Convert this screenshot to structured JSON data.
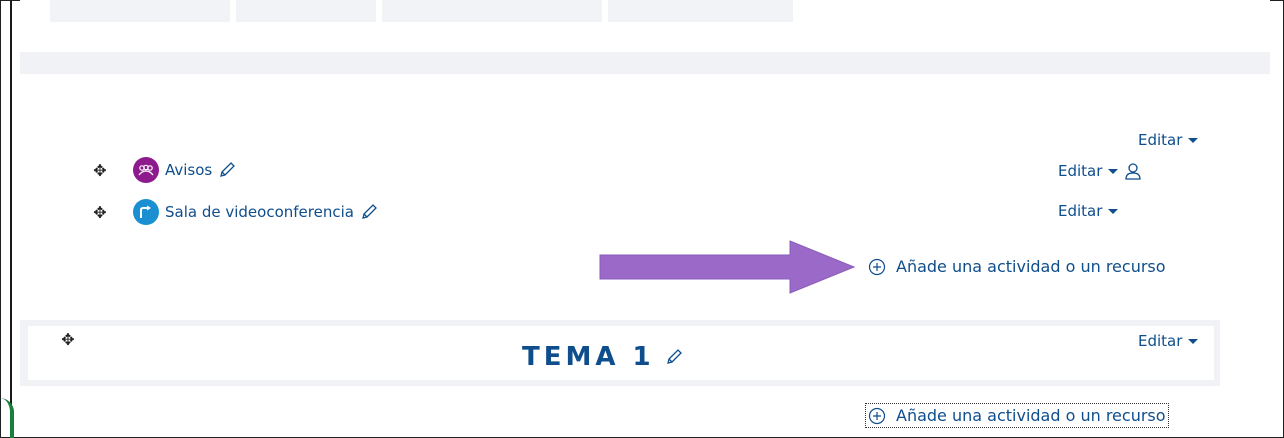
{
  "header_section": {
    "edit_label": "Editar"
  },
  "activities": [
    {
      "name": "Avisos",
      "icon": "forum-icon",
      "icon_color": "#8e1b8e",
      "edit_label": "Editar"
    },
    {
      "name": "Sala de videoconferencia",
      "icon": "url-icon",
      "icon_color": "#1a8fd1",
      "edit_label": "Editar"
    }
  ],
  "add_activity_label": "Añade una actividad o un recurso",
  "topic": {
    "title": "TEMA 1",
    "edit_label": "Editar",
    "add_activity_label": "Añade una actividad o un recurso"
  },
  "colors": {
    "link": "#0f4e8c",
    "arrow": "#9b6ac9",
    "section_bg": "#f0f2f6"
  }
}
